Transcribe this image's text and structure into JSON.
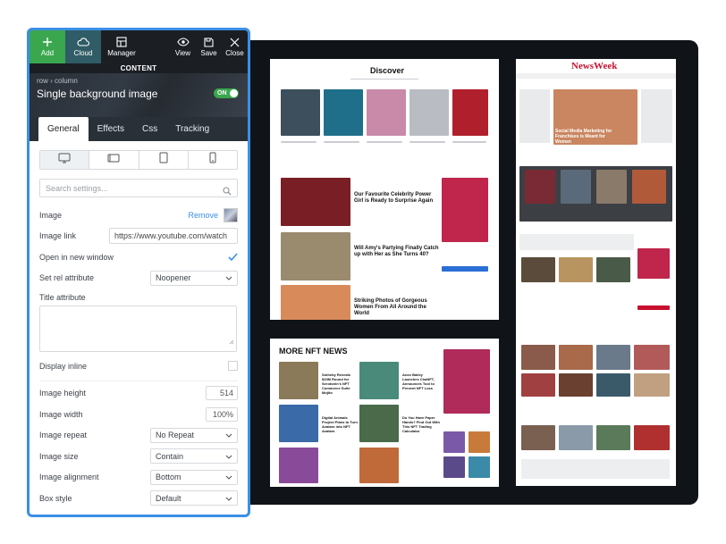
{
  "toolbar": {
    "add_label": "Add",
    "cloud_label": "Cloud",
    "manager_label": "Manager",
    "view_label": "View",
    "save_label": "Save",
    "close_label": "Close"
  },
  "section_label": "CONTENT",
  "header": {
    "breadcrumb": "row  ›  column",
    "title": "Single background image",
    "toggle_label": "ON"
  },
  "tabs": [
    {
      "label": "General"
    },
    {
      "label": "Effects"
    },
    {
      "label": "Css"
    },
    {
      "label": "Tracking"
    }
  ],
  "search": {
    "placeholder": "Search settings..."
  },
  "settings": {
    "image_label": "Image",
    "image_remove": "Remove",
    "image_link_label": "Image link",
    "image_link_value": "https://www.youtube.com/watch",
    "open_new_window_label": "Open in new window",
    "set_rel_label": "Set rel attribute",
    "set_rel_value": "Noopener",
    "title_attr_label": "Title attribute",
    "display_inline_label": "Display inline",
    "image_height_label": "Image height",
    "image_height_value": "514",
    "image_width_label": "Image width",
    "image_width_value": "100%",
    "image_repeat_label": "Image repeat",
    "image_repeat_value": "No Repeat",
    "image_size_label": "Image size",
    "image_size_value": "Contain",
    "image_alignment_label": "Image alignment",
    "image_alignment_value": "Bottom",
    "box_style_label": "Box style",
    "box_style_value": "Default"
  },
  "previews": {
    "discover_title": "Discover",
    "newsweek_title": "NewsWeek",
    "nft_title": "MORE NFT NEWS",
    "article_1": "Our Favourite Celebrity Power Girl is Ready to Surprise Again",
    "article_2": "Will Amy's Partying Finally Catch up with Her as She Turns 40?",
    "article_3": "Striking Photos of Gorgeous Women From All Around the World",
    "nw_feature": "Social Media Marketing for Franchises is Meant for Women",
    "nft_1": "Sotheby Reveals $20M Round for Serotonin's NFT Commerce Suite Mojito",
    "nft_2": "Digital Animals Project Plans to Turn Avatars into NFT Avatars",
    "nft_3": "Do You Have Paper Hands? Find Out With This NFT Trading Calculator",
    "nft_4": "Aeon Bailey Launches ChaNFT, Announces Tool to Prevent NFT Loss"
  }
}
